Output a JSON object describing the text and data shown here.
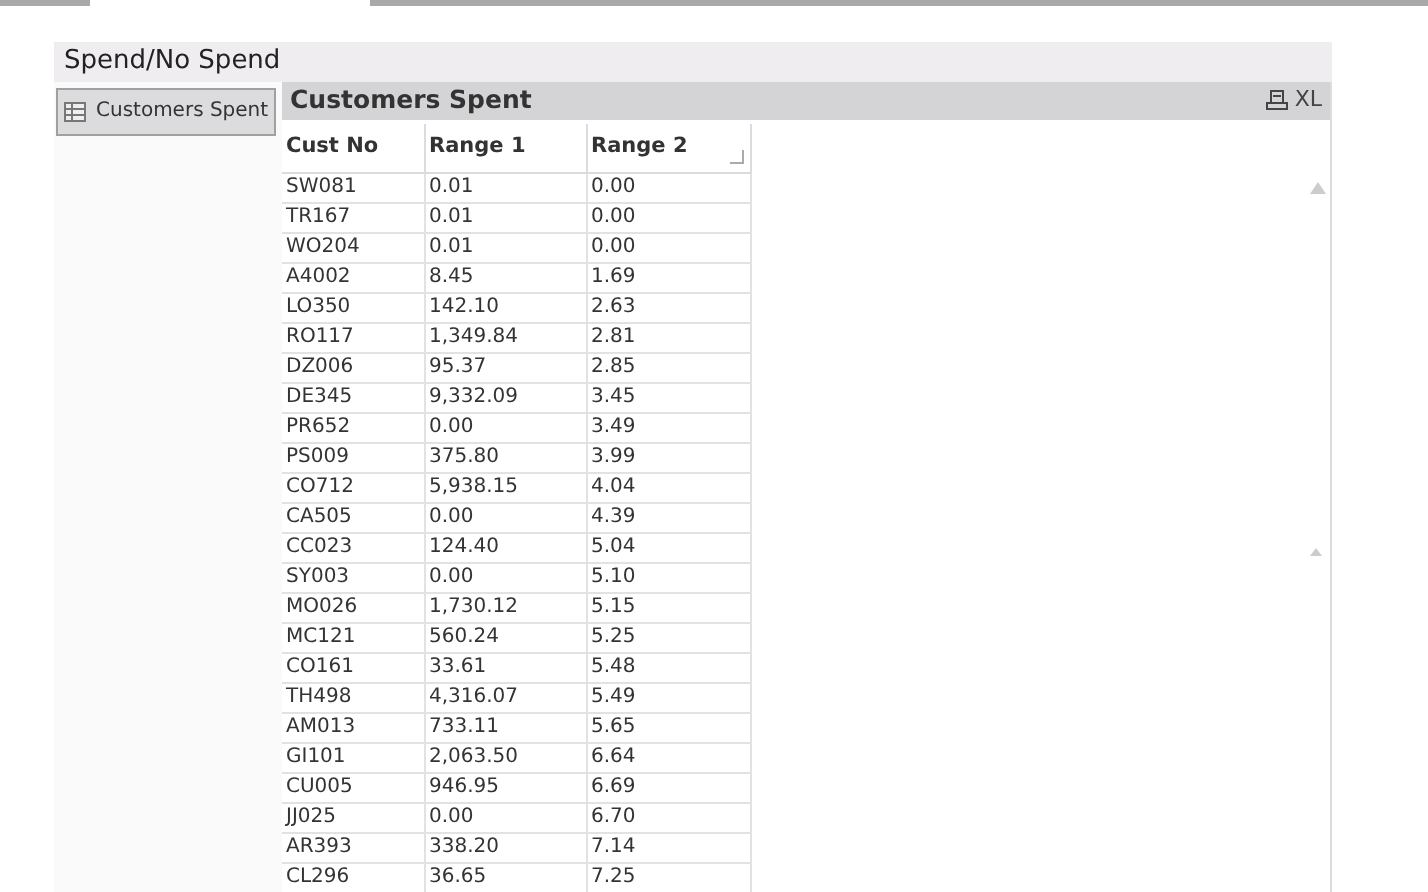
{
  "sheet": {
    "title": "Spend/No Spend"
  },
  "sidebar": {
    "button": "Customers Spent"
  },
  "table_box": {
    "title": "Customers Spent",
    "export_label": "XL",
    "columns": [
      {
        "label": "Cust No",
        "sorted": false
      },
      {
        "label": "Range 1",
        "sorted": false
      },
      {
        "label": "Range 2",
        "sorted": true
      }
    ],
    "rows": [
      [
        "SW081",
        "0.01",
        "0.00"
      ],
      [
        "TR167",
        "0.01",
        "0.00"
      ],
      [
        "WO204",
        "0.01",
        "0.00"
      ],
      [
        "A4002",
        "8.45",
        "1.69"
      ],
      [
        "LO350",
        "142.10",
        "2.63"
      ],
      [
        "RO117",
        "1,349.84",
        "2.81"
      ],
      [
        "DZ006",
        "95.37",
        "2.85"
      ],
      [
        "DE345",
        "9,332.09",
        "3.45"
      ],
      [
        "PR652",
        "0.00",
        "3.49"
      ],
      [
        "PS009",
        "375.80",
        "3.99"
      ],
      [
        "CO712",
        "5,938.15",
        "4.04"
      ],
      [
        "CA505",
        "0.00",
        "4.39"
      ],
      [
        "CC023",
        "124.40",
        "5.04"
      ],
      [
        "SY003",
        "0.00",
        "5.10"
      ],
      [
        "MO026",
        "1,730.12",
        "5.15"
      ],
      [
        "MC121",
        "560.24",
        "5.25"
      ],
      [
        "CO161",
        "33.61",
        "5.48"
      ],
      [
        "TH498",
        "4,316.07",
        "5.49"
      ],
      [
        "AM013",
        "733.11",
        "5.65"
      ],
      [
        "GI101",
        "2,063.50",
        "6.64"
      ],
      [
        "CU005",
        "946.95",
        "6.69"
      ],
      [
        "JJ025",
        "0.00",
        "6.70"
      ],
      [
        "AR393",
        "338.20",
        "7.14"
      ],
      [
        "CL296",
        "36.65",
        "7.25"
      ]
    ]
  }
}
